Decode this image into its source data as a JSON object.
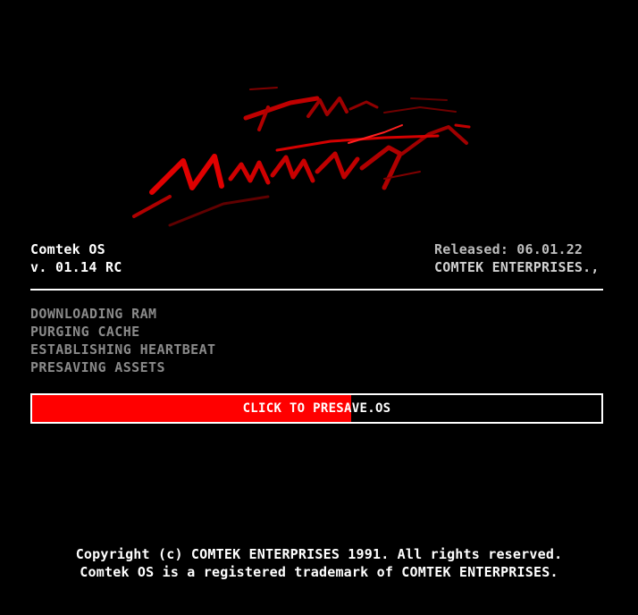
{
  "app": {
    "name": "Comtek OS",
    "version": "v. 01.14 RC"
  },
  "release": {
    "released": "Released: 06.01.22",
    "company": "COMTEK ENTERPRISES.,"
  },
  "status_lines": [
    "DOWNLOADING RAM",
    "PURGING CACHE",
    "ESTABLISHING HEARTBEAT",
    "PRESAVING ASSETS"
  ],
  "presave": {
    "label": "CLICK TO PRESAVE.OS",
    "progress_percent": 56,
    "fill_color": "#ff0000"
  },
  "footer": {
    "line1": "Copyright (c) COMTEK ENTERPRISES 1991. All rights reserved.",
    "line2": "Comtek OS is a registered trademark of COMTEK ENTERPRISES."
  },
  "colors": {
    "background": "#000000",
    "accent": "#ff0000",
    "status_text": "#8a8a8a",
    "release_text": "#bdbdbd"
  }
}
